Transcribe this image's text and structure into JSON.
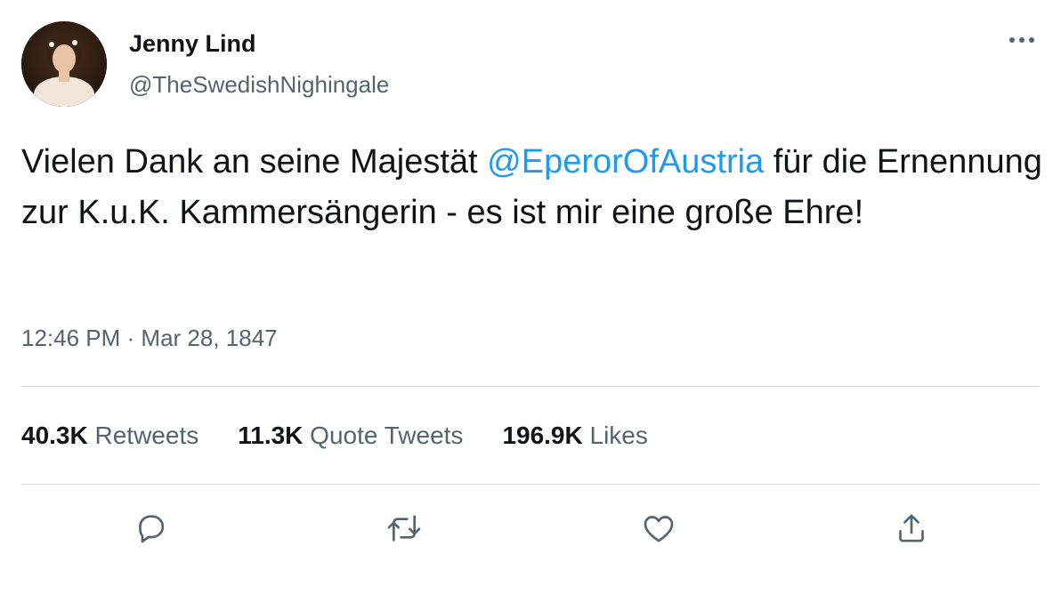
{
  "author": {
    "name": "Jenny Lind",
    "handle": "@TheSwedishNighingale"
  },
  "tweet": {
    "text_before": "Vielen Dank an seine Majestät ",
    "mention": "@EperorOfAustria",
    "text_after": " für die Ernennung zur K.u.K. Kammersängerin - es ist mir eine große Ehre!",
    "time": "12:46 PM",
    "separator": " · ",
    "date": "Mar 28, 1847"
  },
  "stats": {
    "retweets": {
      "count": "40.3K",
      "label": "Retweets"
    },
    "quotes": {
      "count": "11.3K",
      "label": "Quote Tweets"
    },
    "likes": {
      "count": "196.9K",
      "label": "Likes"
    }
  },
  "colors": {
    "accent": "#1d9bf0",
    "text": "#0f1419",
    "secondary": "#536471",
    "divider": "#cfd9de"
  },
  "icons": [
    "more-icon",
    "reply-icon",
    "retweet-icon",
    "like-icon",
    "share-icon"
  ]
}
